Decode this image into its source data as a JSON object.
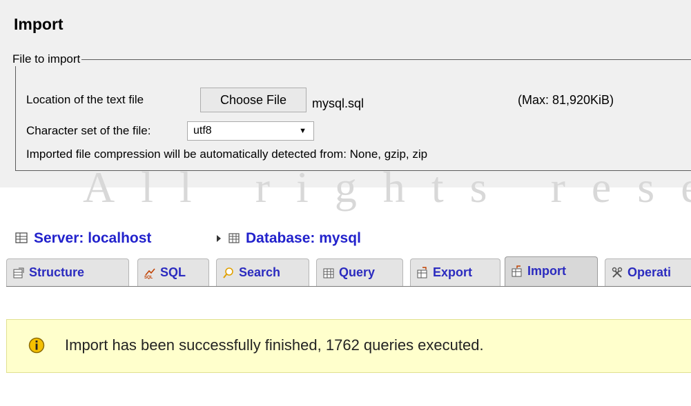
{
  "import_panel": {
    "title": "Import",
    "fieldset_legend": "File to import",
    "location_label": "Location of the text file",
    "choose_file_label": "Choose File",
    "selected_file": "mysql.sql",
    "max_size": "(Max: 81,920KiB)",
    "charset_label": "Character set of the file:",
    "charset_value": "utf8",
    "compression_note": "Imported file compression will be automatically detected from: None, gzip, zip"
  },
  "watermark": "All rights reserved",
  "breadcrumb": {
    "server": "Server: localhost",
    "database": "Database: mysql"
  },
  "tabs": [
    {
      "label": "Structure",
      "icon": "structure-icon"
    },
    {
      "label": "SQL",
      "icon": "sql-icon"
    },
    {
      "label": "Search",
      "icon": "search-icon"
    },
    {
      "label": "Query",
      "icon": "query-icon"
    },
    {
      "label": "Export",
      "icon": "export-icon"
    },
    {
      "label": "Import",
      "icon": "import-icon",
      "active": true
    },
    {
      "label": "Operati",
      "icon": "operations-icon"
    }
  ],
  "message": {
    "text": "Import has been successfully finished, 1762 queries executed.",
    "icon": "info-icon"
  },
  "colors": {
    "link": "#2222cc",
    "tab_text": "#2b2bbf",
    "notice_bg": "#ffffcc",
    "notice_icon": "#f0b400"
  }
}
